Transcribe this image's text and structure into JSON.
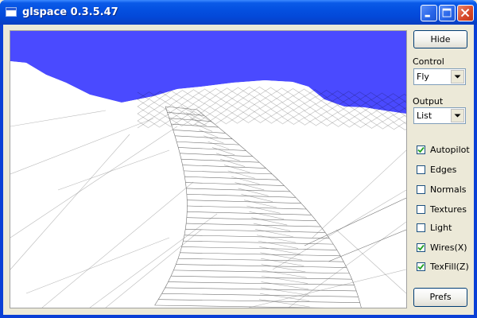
{
  "window": {
    "title": "glspace 0.3.5.47"
  },
  "viewport": {
    "sky_color": "#4a4aff",
    "mesh_color": "#000000"
  },
  "sidebar": {
    "hide_label": "Hide",
    "control_label": "Control",
    "control_value": "Fly",
    "output_label": "Output",
    "output_value": "List",
    "options": [
      {
        "label": "Autopilot",
        "checked": true
      },
      {
        "label": "Edges",
        "checked": false
      },
      {
        "label": "Normals",
        "checked": false
      },
      {
        "label": "Textures",
        "checked": false
      },
      {
        "label": "Light",
        "checked": false
      },
      {
        "label": "Wires(X)",
        "checked": true
      },
      {
        "label": "TexFill(Z)",
        "checked": true
      }
    ],
    "prefs_label": "Prefs"
  },
  "colors": {
    "title_bar": "#0a5ae8",
    "face": "#ece9d8",
    "close_button": "#d6482a"
  },
  "icons": {
    "title": "window-icon",
    "minimize": "minimize-icon",
    "maximize": "maximize-icon",
    "close": "close-icon",
    "dropdown": "chevron-down-icon",
    "check": "checkmark-icon"
  }
}
